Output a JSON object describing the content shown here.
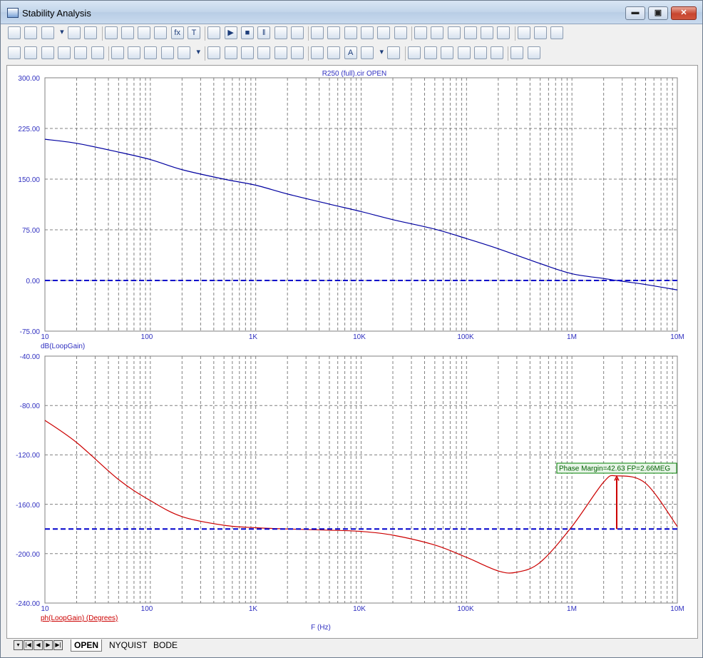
{
  "window": {
    "title": "Stability Analysis"
  },
  "caption_buttons": {
    "minimize": "▬",
    "maximize": "▣",
    "close": "✕"
  },
  "toolbar_icons_row1": [
    "select-arrow-icon",
    "pan-hand-icon",
    "tiles-icon",
    "dropdown-arrow-icon",
    "chart-icon",
    "zoom-fit-icon",
    "plot-icon",
    "plot-xy-icon",
    "plot-3d-icon",
    "plot-y-icon",
    "function-icon",
    "text-icon",
    "properties-icon",
    "run-icon",
    "stop-icon",
    "pause-icon",
    "cursor-left-icon",
    "cursor-right-icon",
    "frame-icon",
    "grid-icon",
    "layout-a-icon",
    "layout-b-icon",
    "layout-c-icon",
    "layout-d-icon",
    "h-line-icon",
    "crosshair-icon",
    "scale-icon",
    "goto-icon",
    "peak-icon",
    "valley-icon",
    "find-icon",
    "format-icon",
    "export-icon"
  ],
  "toolbar_icons_row2": [
    "marker-1-icon",
    "marker-2-icon",
    "marker-3-icon",
    "marker-4-icon",
    "marker-5-icon",
    "marker-6-icon",
    "marker-7-icon",
    "marker-8-icon",
    "marker-9-icon",
    "marker-10-icon",
    "clipboard-icon",
    "dropdown-arrow-icon",
    "list-icon",
    "table-icon",
    "tag-h-icon",
    "tag-v-icon",
    "zoom-in-icon",
    "zoom-out-icon",
    "zoom-100-icon",
    "dots-icon",
    "font-icon",
    "text-format-icon",
    "dropdown-arrow-icon",
    "copy-icon",
    "arrange-a-icon",
    "arrange-b-icon",
    "align-left-icon",
    "align-center-icon",
    "align-right-icon",
    "align-top-icon",
    "align-middle-icon",
    "align-bottom-icon"
  ],
  "glyphs": {
    "text-icon": "T",
    "function-icon": "fx",
    "font-icon": "A",
    "run-icon": "▶",
    "stop-icon": "■",
    "pause-icon": "‖",
    "dropdown-arrow-icon": "▾"
  },
  "colors": {
    "magnitude": "#0000a0",
    "phase": "#cc0000",
    "reference": "#0000cc",
    "grid": "#808080",
    "axis_label_blue": "#3030c0",
    "annotation_box": "#008000"
  },
  "top_plot": {
    "header": "R250 (full).cir OPEN",
    "y_ticks": [
      "300.00",
      "225.00",
      "150.00",
      "75.00",
      "0.00",
      "-75.00"
    ],
    "x_ticks": [
      "10",
      "100",
      "1K",
      "10K",
      "100K",
      "1M",
      "10M"
    ],
    "y_label": "dB(LoopGain)"
  },
  "bottom_plot": {
    "y_ticks": [
      "-40.00",
      "-80.00",
      "-120.00",
      "-160.00",
      "-200.00",
      "-240.00"
    ],
    "x_ticks": [
      "10",
      "100",
      "1K",
      "10K",
      "100K",
      "1M",
      "10M"
    ],
    "y_label": "ph(LoopGain) (Degrees)",
    "annotation": "Phase Margin=42.63 FP=2.66MEG"
  },
  "x_axis_title": "F (Hz)",
  "tabs": [
    "OPEN",
    "NYQUIST",
    "BODE"
  ],
  "chart_data": [
    {
      "type": "line",
      "title": "R250 (full).cir OPEN",
      "xlabel": "",
      "ylabel": "dB(LoopGain)",
      "x_scale": "log",
      "xlim": [
        10,
        10000000
      ],
      "ylim": [
        -75,
        300
      ],
      "grid": true,
      "series": [
        {
          "name": "dB(LoopGain)",
          "x": [
            10,
            20,
            50,
            100,
            200,
            500,
            1000,
            2000,
            5000,
            10000,
            20000,
            50000,
            100000,
            200000,
            500000,
            1000000,
            2000000,
            2660000,
            5000000,
            10000000
          ],
          "y": [
            209,
            203,
            190,
            179,
            164,
            150,
            141,
            128,
            113,
            102,
            90,
            76,
            62,
            47,
            25,
            10,
            3,
            0,
            -6,
            -14
          ]
        },
        {
          "name": "reference",
          "x": [
            10,
            10000000
          ],
          "y": [
            0,
            0
          ]
        }
      ]
    },
    {
      "type": "line",
      "title": "",
      "xlabel": "F (Hz)",
      "ylabel": "ph(LoopGain) (Degrees)",
      "x_scale": "log",
      "xlim": [
        10,
        10000000
      ],
      "ylim": [
        -240,
        -40
      ],
      "grid": true,
      "series": [
        {
          "name": "ph(LoopGain) (Degrees)",
          "x": [
            10,
            20,
            50,
            100,
            200,
            500,
            1000,
            2000,
            5000,
            10000,
            20000,
            50000,
            100000,
            200000,
            300000,
            500000,
            1000000,
            2000000,
            2660000,
            5000000,
            10000000
          ],
          "y": [
            -92,
            -110,
            -140,
            -157,
            -170,
            -177,
            -179,
            -180,
            -181,
            -182,
            -185,
            -193,
            -203,
            -214,
            -215,
            -207,
            -178,
            -142,
            -137,
            -143,
            -178
          ]
        },
        {
          "name": "reference",
          "x": [
            10,
            10000000
          ],
          "y": [
            -180,
            -180
          ]
        }
      ],
      "annotations": [
        {
          "text": "Phase Margin=42.63 FP=2.66MEG",
          "x": 2660000,
          "y_from": -180,
          "y_to": -137.37
        }
      ]
    }
  ]
}
